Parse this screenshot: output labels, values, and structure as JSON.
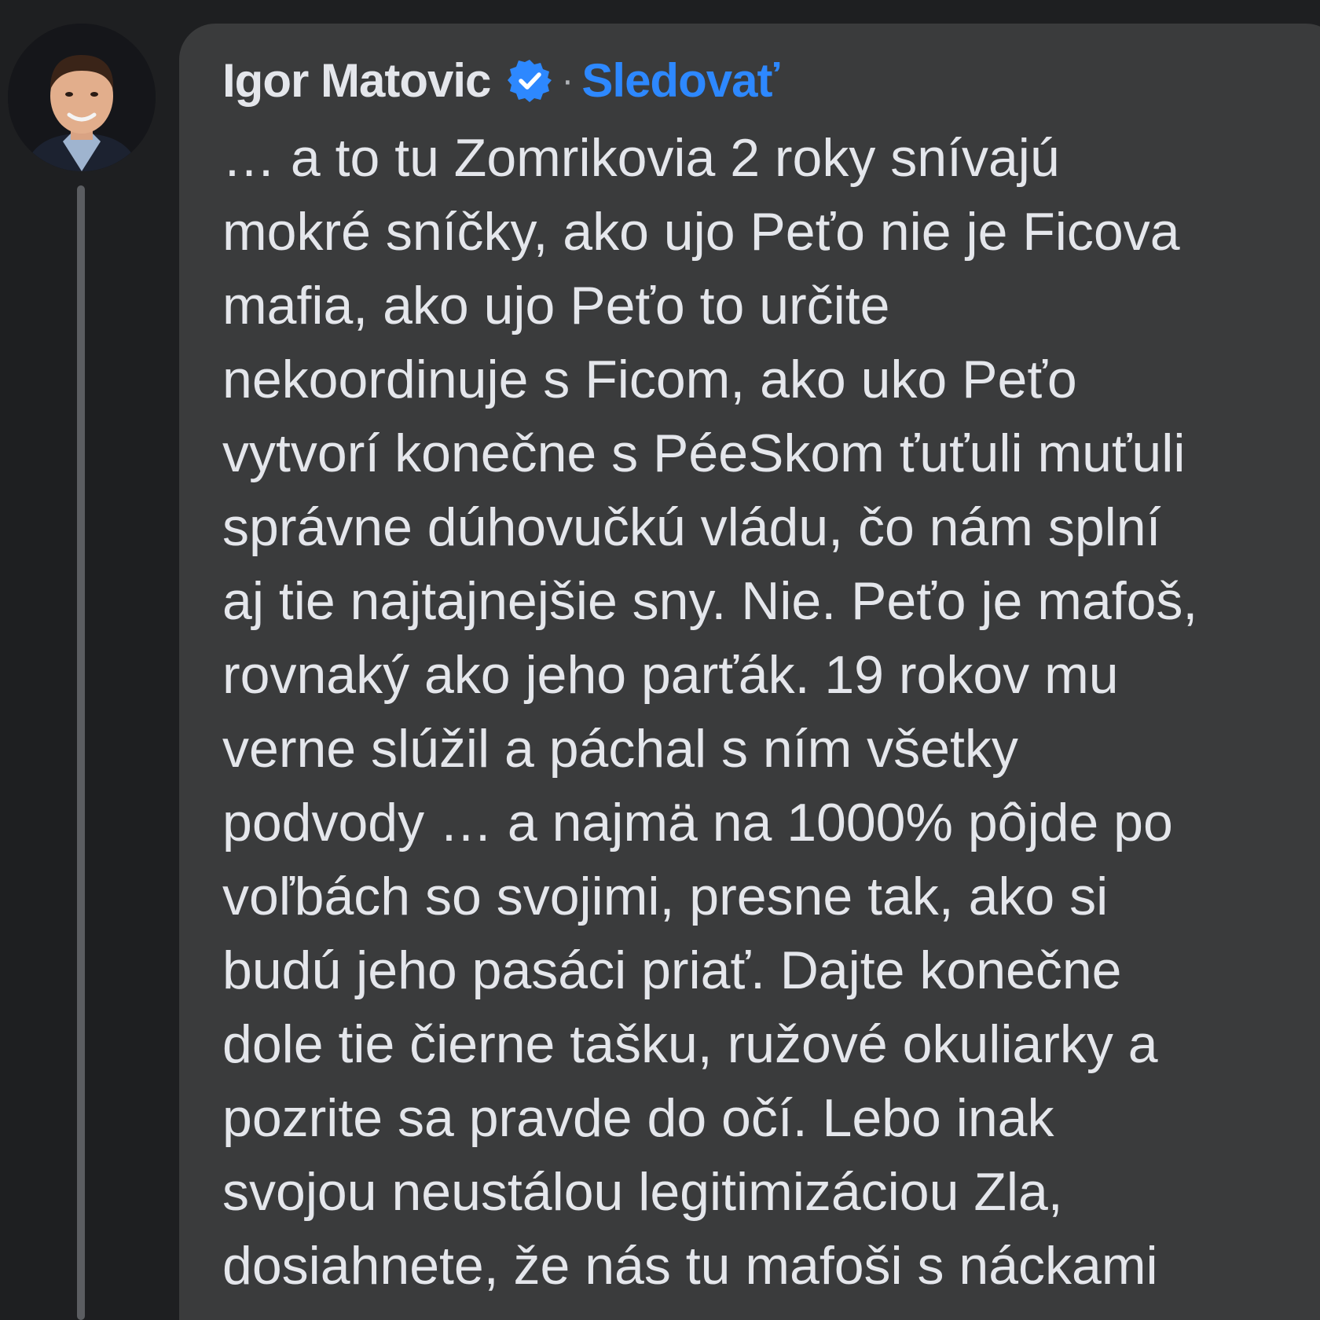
{
  "post": {
    "author": "Igor Matovic",
    "verified": true,
    "verified_icon": "verified-badge-icon",
    "separator": "·",
    "follow_label": "Sledovať",
    "accent_color": "#2d88ff",
    "lines": [
      "… a to tu Zomrikovia 2 roky snívajú",
      "mokré sníčky, ako ujo Peťo nie je Ficova",
      "mafia, ako ujo Peťo to určite",
      "nekoordinuje s Ficom, ako uko Peťo",
      "vytvorí konečne s PéeSkom ťuťuli muťuli",
      "správne dúhovučkú vládu, čo nám splní",
      "aj tie najtajnejšie sny. Nie. Peťo je mafoš,",
      "rovnaký ako jeho parťák. 19 rokov mu",
      "verne slúžil a páchal s ním všetky",
      "podvody … a najmä na 1000% pôjde po",
      "voľbách so svojimi, presne tak, ako si",
      "budú jeho pasáci priať. Dajte konečne",
      "dole tie čierne tašku, ružové okuliarky a",
      "pozrite sa pravde do očí. Lebo inak",
      "svojou neustálou legitimizáciou Zla,",
      "dosiahnete, že nás tu mafoši s náckami"
    ]
  }
}
